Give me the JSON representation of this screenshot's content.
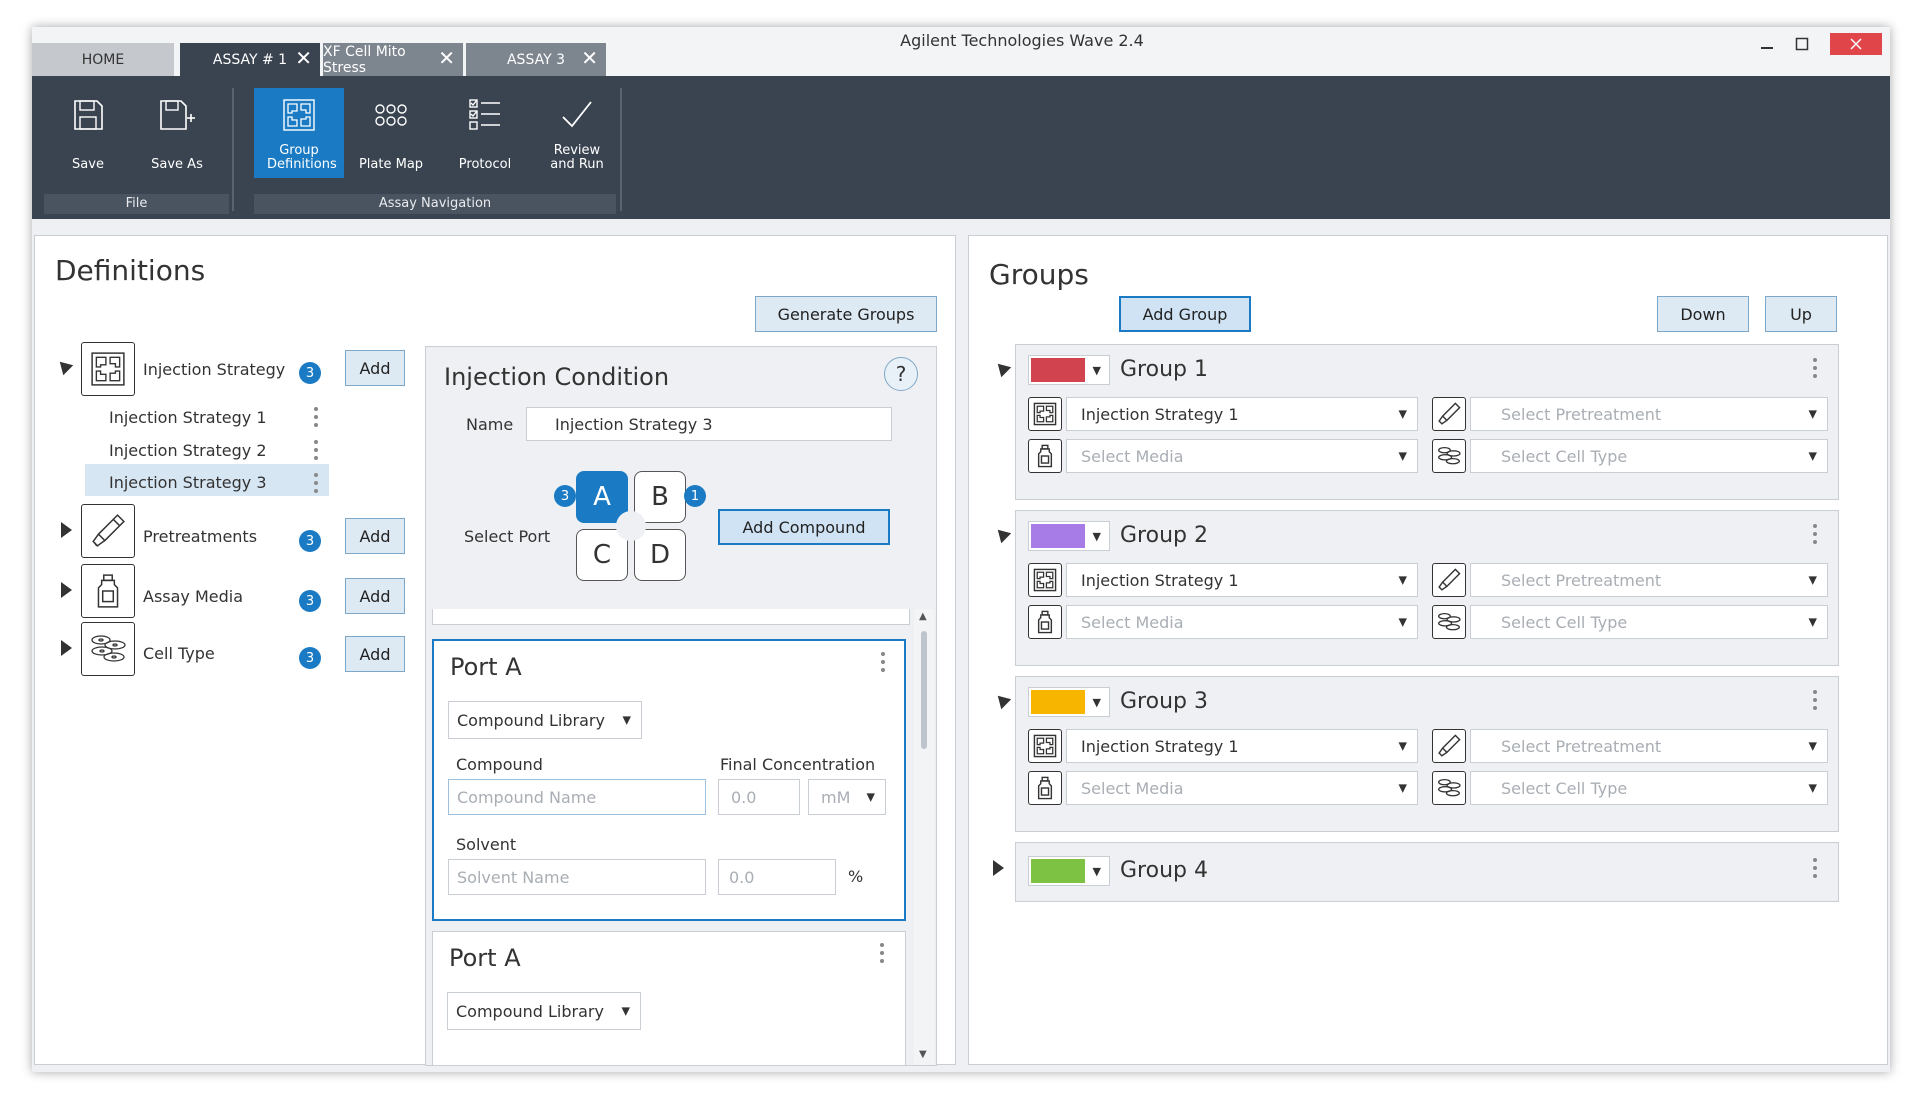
{
  "window": {
    "title": "Agilent Technologies Wave 2.4",
    "tabs": [
      {
        "label": "HOME"
      },
      {
        "label": "ASSAY # 1"
      },
      {
        "label": "XF Cell Mito Stress"
      },
      {
        "label": "ASSAY 3"
      }
    ]
  },
  "ribbon": {
    "file": {
      "label": "File",
      "save": "Save",
      "save_as": "Save As"
    },
    "nav": {
      "label": "Assay Navigation",
      "group_definitions": "Group Definitions",
      "plate_map": "Plate Map",
      "protocol": "Protocol",
      "review_and_run": "Review and Run"
    }
  },
  "definitions": {
    "title": "Definitions",
    "generate_groups": "Generate Groups",
    "add_label": "Add",
    "categories": [
      {
        "label": "Injection Strategy",
        "count": "3"
      },
      {
        "label": "Pretreatments",
        "count": "3"
      },
      {
        "label": "Assay Media",
        "count": "3"
      },
      {
        "label": "Cell Type",
        "count": "3"
      }
    ],
    "strategies": [
      "Injection Strategy 1",
      "Injection Strategy 2",
      "Injection Strategy 3"
    ]
  },
  "injection_condition": {
    "title": "Injection Condition",
    "help": "?",
    "name_label": "Name",
    "name_value": "Injection Strategy 3",
    "select_port_label": "Select Port",
    "ports": [
      "A",
      "B",
      "C",
      "D"
    ],
    "port_a_badge": "3",
    "port_b_badge": "1",
    "add_compound": "Add Compound",
    "cards": [
      {
        "title": "Port A",
        "library": "Compound Library",
        "compound_label": "Compound",
        "final_conc_label": "Final Concentration",
        "compound_placeholder": "Compound Name",
        "conc_placeholder": "0.0",
        "unit": "mM",
        "solvent_label": "Solvent",
        "solvent_placeholder": "Solvent Name",
        "solvent_pct_placeholder": "0.0",
        "pct": "%"
      },
      {
        "title": "Port A",
        "library": "Compound Library"
      }
    ]
  },
  "groups": {
    "title": "Groups",
    "add_group": "Add Group",
    "down": "Down",
    "up": "Up",
    "items": [
      {
        "name": "Group 1",
        "color": "#d0434f",
        "strategy": "Injection Strategy 1",
        "pretreatment": "Select Pretreatment",
        "media": "Select Media",
        "cell_type": "Select Cell Type"
      },
      {
        "name": "Group 2",
        "color": "#a77ce6",
        "strategy": "Injection Strategy 1",
        "pretreatment": "Select Pretreatment",
        "media": "Select Media",
        "cell_type": "Select Cell Type"
      },
      {
        "name": "Group 3",
        "color": "#f7b500",
        "strategy": "Injection Strategy 1",
        "pretreatment": "Select Pretreatment",
        "media": "Select Media",
        "cell_type": "Select Cell Type"
      },
      {
        "name": "Group 4",
        "color": "#7dc242"
      }
    ]
  }
}
